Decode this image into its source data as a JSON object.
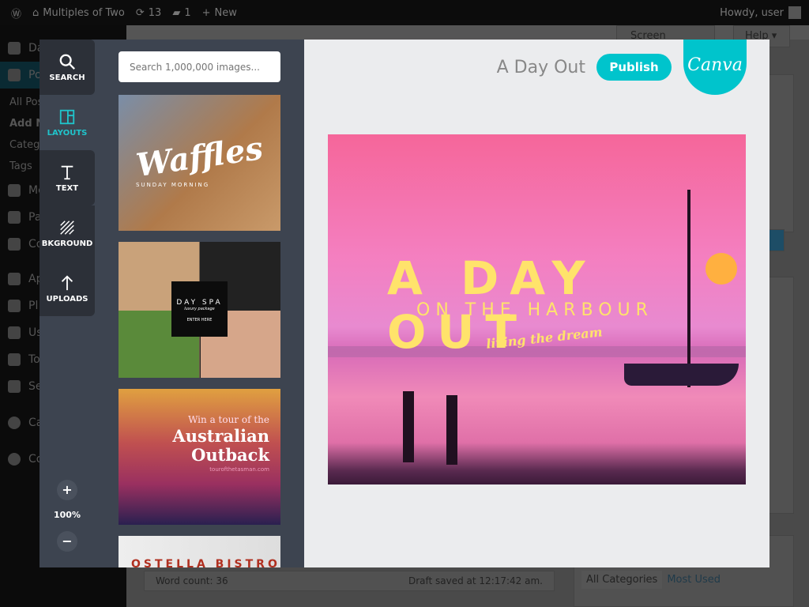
{
  "adminbar": {
    "site": "Multiples of Two",
    "updates": "13",
    "comments": "1",
    "new": "New",
    "howdy": "Howdy, user"
  },
  "wp_sidebar": {
    "items": [
      "Da",
      "Po",
      "All Pos",
      "Add N",
      "Categ",
      "Tags",
      "Me",
      "Pa",
      "Co",
      "Ap",
      "Pl",
      "Us",
      "To",
      "Se",
      "Ca",
      "Co"
    ]
  },
  "wp_main": {
    "screen_options": "Screen Options ▾",
    "help": "Help ▾",
    "word_count": "Word count: 36",
    "draft_saved": "Draft saved at 12:17:42 am.",
    "cat_tabs": [
      "All Categories",
      "Most Used"
    ]
  },
  "canva": {
    "tools": [
      {
        "label": "SEARCH",
        "icon": "search-icon"
      },
      {
        "label": "LAYOUTS",
        "icon": "layouts-icon"
      },
      {
        "label": "TEXT",
        "icon": "text-icon"
      },
      {
        "label": "BKGROUND",
        "icon": "background-icon"
      },
      {
        "label": "UPLOADS",
        "icon": "upload-icon"
      }
    ],
    "zoom_in": "+",
    "zoom_level": "100%",
    "zoom_out": "−",
    "search_placeholder": "Search 1,000,000 images...",
    "layouts": [
      {
        "title": "Waffles",
        "subtitle": "SUNDAY MORNING"
      },
      {
        "title": "DAY SPA",
        "subtitle": "luxury package",
        "cta": "ENTER HERE"
      },
      {
        "line1": "Win a tour of the",
        "title": "Australian Outback",
        "url": "tourofthetasman.com"
      },
      {
        "title": "OSTELLA BISTRO"
      }
    ],
    "doc_title": "A Day Out",
    "publish": "Publish",
    "logo": "Canva",
    "design": {
      "title": "A DAY OUT",
      "subtitle": "ON THE HARBOUR",
      "tagline": "living the dream"
    },
    "accent": "#00c4cc"
  }
}
